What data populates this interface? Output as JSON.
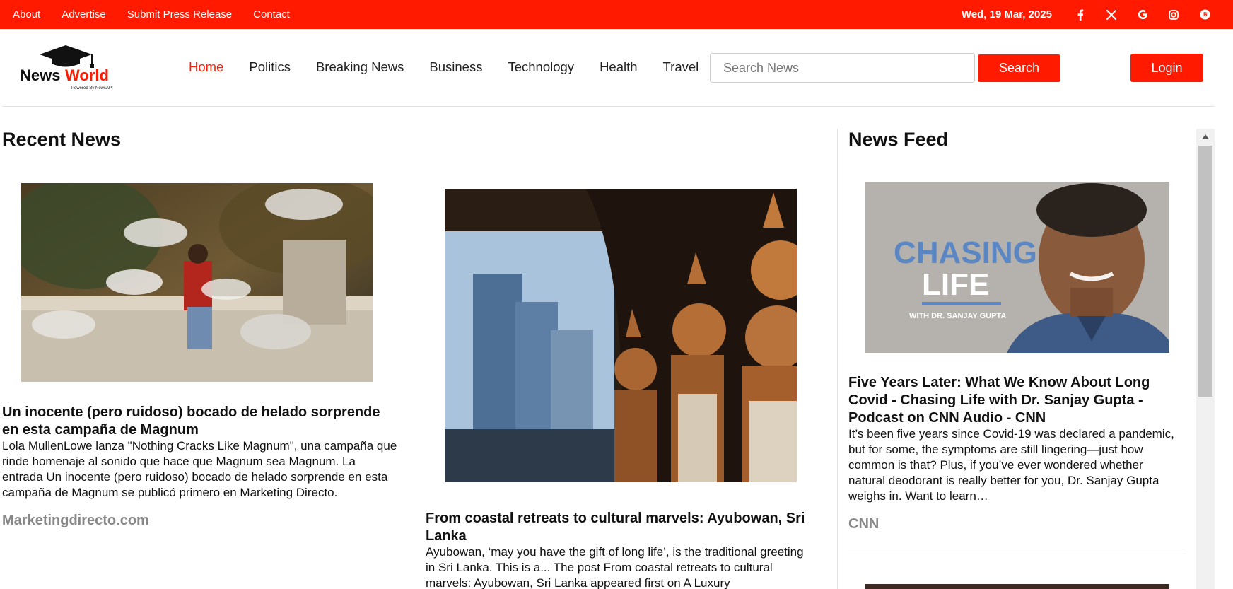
{
  "topbar": {
    "links": [
      "About",
      "Advertise",
      "Submit Press Release",
      "Contact"
    ],
    "date": "Wed, 19 Mar, 2025",
    "social_icons": [
      "facebook-icon",
      "x-icon",
      "google-icon",
      "instagram-icon",
      "bitcoin-icon"
    ]
  },
  "logo": {
    "text_news": "News",
    "text_world": "World",
    "tagline": "Powered By NewsAPI"
  },
  "nav": {
    "items": [
      "Home",
      "Politics",
      "Breaking News",
      "Business",
      "Technology",
      "Health",
      "Travel"
    ],
    "active": "Home"
  },
  "search": {
    "placeholder": "Search News",
    "button_label": "Search"
  },
  "login_label": "Login",
  "recent": {
    "title": "Recent News",
    "articles": [
      {
        "title": "Un inocente (pero ruidoso) bocado de helado sorprende en esta campaña de Magnum",
        "description": "Lola MullenLowe lanza \"Nothing Cracks Like Magnum\", una campaña que rinde homenaje al sonido que hace que Magnum sea Magnum. La entrada Un inocente (pero ruidoso) bocado de helado sorprende en esta campaña de Magnum se publicó primero en Marketing Directo.",
        "source": "Marketingdirecto.com"
      },
      {
        "title": "From coastal retreats to cultural marvels: Ayubowan, Sri Lanka",
        "description": "Ayubowan, ‘may you have the gift of long life’, is the traditional greeting in Sri Lanka. This is a... The post From coastal retreats to cultural marvels: Ayubowan, Sri Lanka appeared first on A Luxury"
      }
    ]
  },
  "feed": {
    "title": "News Feed",
    "articles": [
      {
        "image_text": {
          "line1": "CHASING",
          "line2": "LIFE",
          "line3": "WITH DR. SANJAY GUPTA"
        },
        "title": "Five Years Later: What We Know About Long Covid - Chasing Life with Dr. Sanjay Gupta - Podcast on CNN Audio - CNN",
        "description": "It’s been five years since Covid-19 was declared a pandemic, but for some, the symptoms are still lingering—just how common is that? Plus, if you’ve ever wondered whether natural deodorant is really better for you, Dr. Sanjay Gupta weighs in.    Want to learn…",
        "source": "CNN"
      }
    ]
  },
  "colors": {
    "brand_red": "#ff1a00",
    "source_gray": "#888888"
  }
}
